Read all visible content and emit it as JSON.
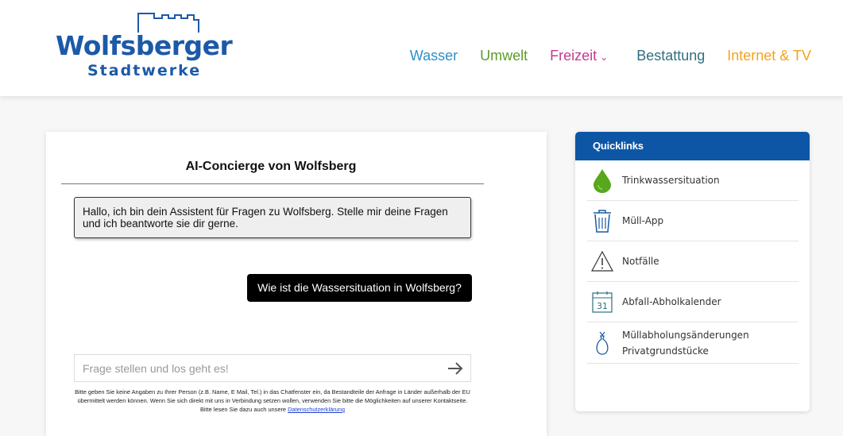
{
  "header": {
    "logo": {
      "line1": "Wolfsberger",
      "line2": "Stadtwerke",
      "color": "#1c5aa8"
    },
    "nav": [
      {
        "label": "Wasser",
        "color": "#2e8fc9"
      },
      {
        "label": "Umwelt",
        "color": "#5c9b2a"
      },
      {
        "label": "Freizeit",
        "color": "#c6398f",
        "has_dropdown": true
      },
      {
        "label": "Bestattung",
        "color": "#2f6f7e"
      },
      {
        "label": "Internet & TV",
        "color": "#f2a31b"
      }
    ]
  },
  "chat": {
    "title": "AI-Concierge von Wolfsberg",
    "messages": [
      {
        "role": "assistant",
        "text": "Hallo, ich bin dein Assistent für Fragen zu Wolfsberg. Stelle mir deine Fragen und ich beantworte sie dir gerne."
      },
      {
        "role": "user",
        "text": "Wie ist die Wassersituation in Wolfsberg?"
      }
    ],
    "input": {
      "placeholder": "Frage stellen und los geht es!",
      "value": ""
    },
    "send_icon": "arrow-right-icon",
    "disclaimer": {
      "text": "Bitte geben Sie keine Angaben zu Ihrer Person (z.B. Name, E Mail, Tel.) in das Chatfenster ein, da Bestandteile der Anfrage in Länder außerhalb der EU übermittelt werden können. Wenn Sie sich direkt mit uns in Verbindung setzen wollen, verwenden Sie bitte die Möglichkeiten auf unserer Kontaktseite. Bitte lesen Sie dazu auch unsere ",
      "link_text": "Datenschutzerklärung"
    }
  },
  "quicklinks": {
    "title": "Quicklinks",
    "header_color": "#0d56a6",
    "items": [
      {
        "label": "Trinkwassersituation",
        "icon": "water-drop-icon"
      },
      {
        "label": "Müll-App",
        "icon": "trash-bin-icon"
      },
      {
        "label": "Notfälle",
        "icon": "warning-triangle-icon"
      },
      {
        "label": "Abfall-Abholkalender",
        "icon": "calendar-icon",
        "icon_text": "31"
      },
      {
        "label": "Müllabholungsänderungen Privatgrundstücke",
        "icon": "garbage-bag-icon"
      }
    ]
  }
}
